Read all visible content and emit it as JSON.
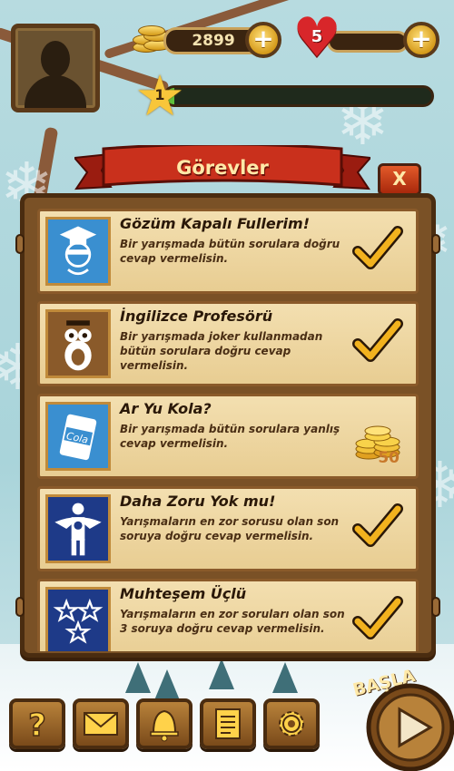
{
  "header": {
    "coins": "2899",
    "hearts": "5",
    "level": "1",
    "level_progress_percent": 3
  },
  "panel": {
    "title": "Görevler",
    "close_label": "X"
  },
  "quests": [
    {
      "title": "Gözüm Kapalı Fullerim!",
      "description": "Bir yarışmada bütün sorulara doğru cevap vermelisin.",
      "icon": "blindfold-graduate-icon",
      "icon_bg": "#3a8fd0",
      "status": "completed"
    },
    {
      "title": "İngilizce Profesörü",
      "description": "Bir yarışmada joker kullanmadan bütün sorulara doğru cevap vermelisin.",
      "icon": "owl-professor-icon",
      "icon_bg": "#8a5a2a",
      "status": "completed"
    },
    {
      "title": "Ar Yu Kola?",
      "description": "Bir yarışmada bütün sorulara yanlış cevap vermelisin.",
      "icon": "cola-can-icon",
      "icon_bg": "#3a8fd0",
      "status": "reward",
      "reward": "50"
    },
    {
      "title": "Daha Zoru Yok mu!",
      "description": "Yarışmaların en zor sorusu olan son soruya doğru cevap vermelisin.",
      "icon": "superhero-icon",
      "icon_bg": "#1e3a88",
      "status": "completed"
    },
    {
      "title": "Muhteşem Üçlü",
      "description": "Yarışmaların en zor soruları olan son 3 soruya doğru cevap vermelisin.",
      "icon": "three-stars-icon",
      "icon_bg": "#1e3a88",
      "status": "completed"
    }
  ],
  "bottom_bar": {
    "buttons": [
      "help-icon",
      "mail-icon",
      "bell-icon",
      "list-icon",
      "gear-icon"
    ],
    "start_label": "BAŞLA"
  }
}
